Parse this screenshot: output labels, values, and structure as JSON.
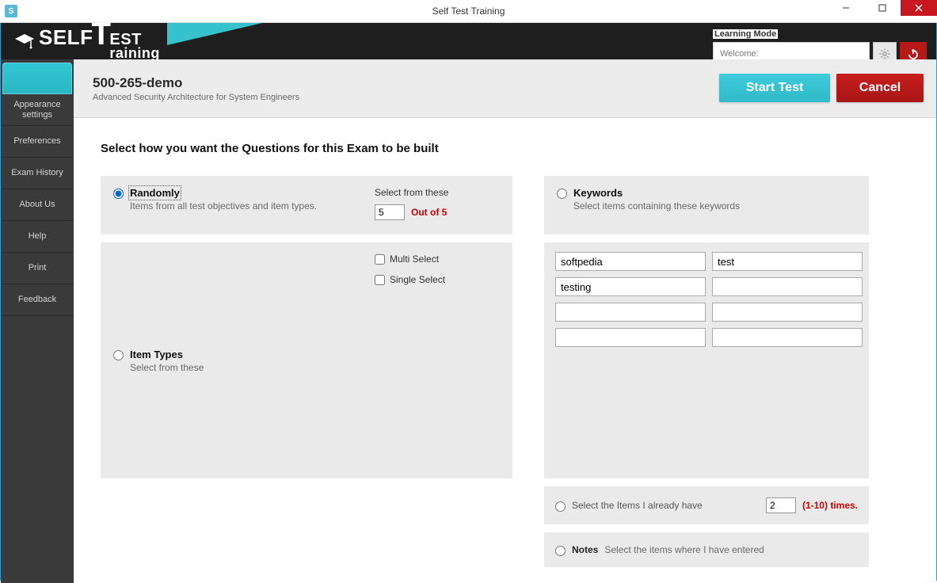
{
  "window": {
    "title": "Self Test Training"
  },
  "header": {
    "learning_mode_label": "Learning Mode",
    "welcome_label": "Welcome:"
  },
  "sidebar": {
    "items": [
      {
        "label": ""
      },
      {
        "label": "Appearance settings"
      },
      {
        "label": "Preferences"
      },
      {
        "label": "Exam History"
      },
      {
        "label": "About Us"
      },
      {
        "label": "Help"
      },
      {
        "label": "Print"
      },
      {
        "label": "Feedback"
      }
    ]
  },
  "content_header": {
    "title": "500-265-demo",
    "subtitle": "Advanced Security Architecture for System Engineers",
    "start_label": "Start Test",
    "cancel_label": "Cancel"
  },
  "body": {
    "heading": "Select how you want the Questions for this Exam to be built",
    "randomly": {
      "label": "Randomly",
      "sub": "Items from all test objectives and item types."
    },
    "select_from": {
      "label": "Select from these",
      "value": "5",
      "out_of": "Out of 5"
    },
    "item_types": {
      "label": "Item Types",
      "sub": "Select from these",
      "checks": {
        "multi": "Multi Select",
        "single": "Single Select"
      }
    },
    "keywords": {
      "label": "Keywords",
      "sub": "Select items containing these keywords",
      "values": [
        "softpedia",
        "test",
        "testing",
        "",
        "",
        "",
        "",
        ""
      ]
    },
    "already_have": {
      "label": "Select the Items I already have",
      "value": "2",
      "suffix": "(1-10) times."
    },
    "notes": {
      "label": "Notes",
      "sub": "Select the items where I have entered"
    }
  }
}
